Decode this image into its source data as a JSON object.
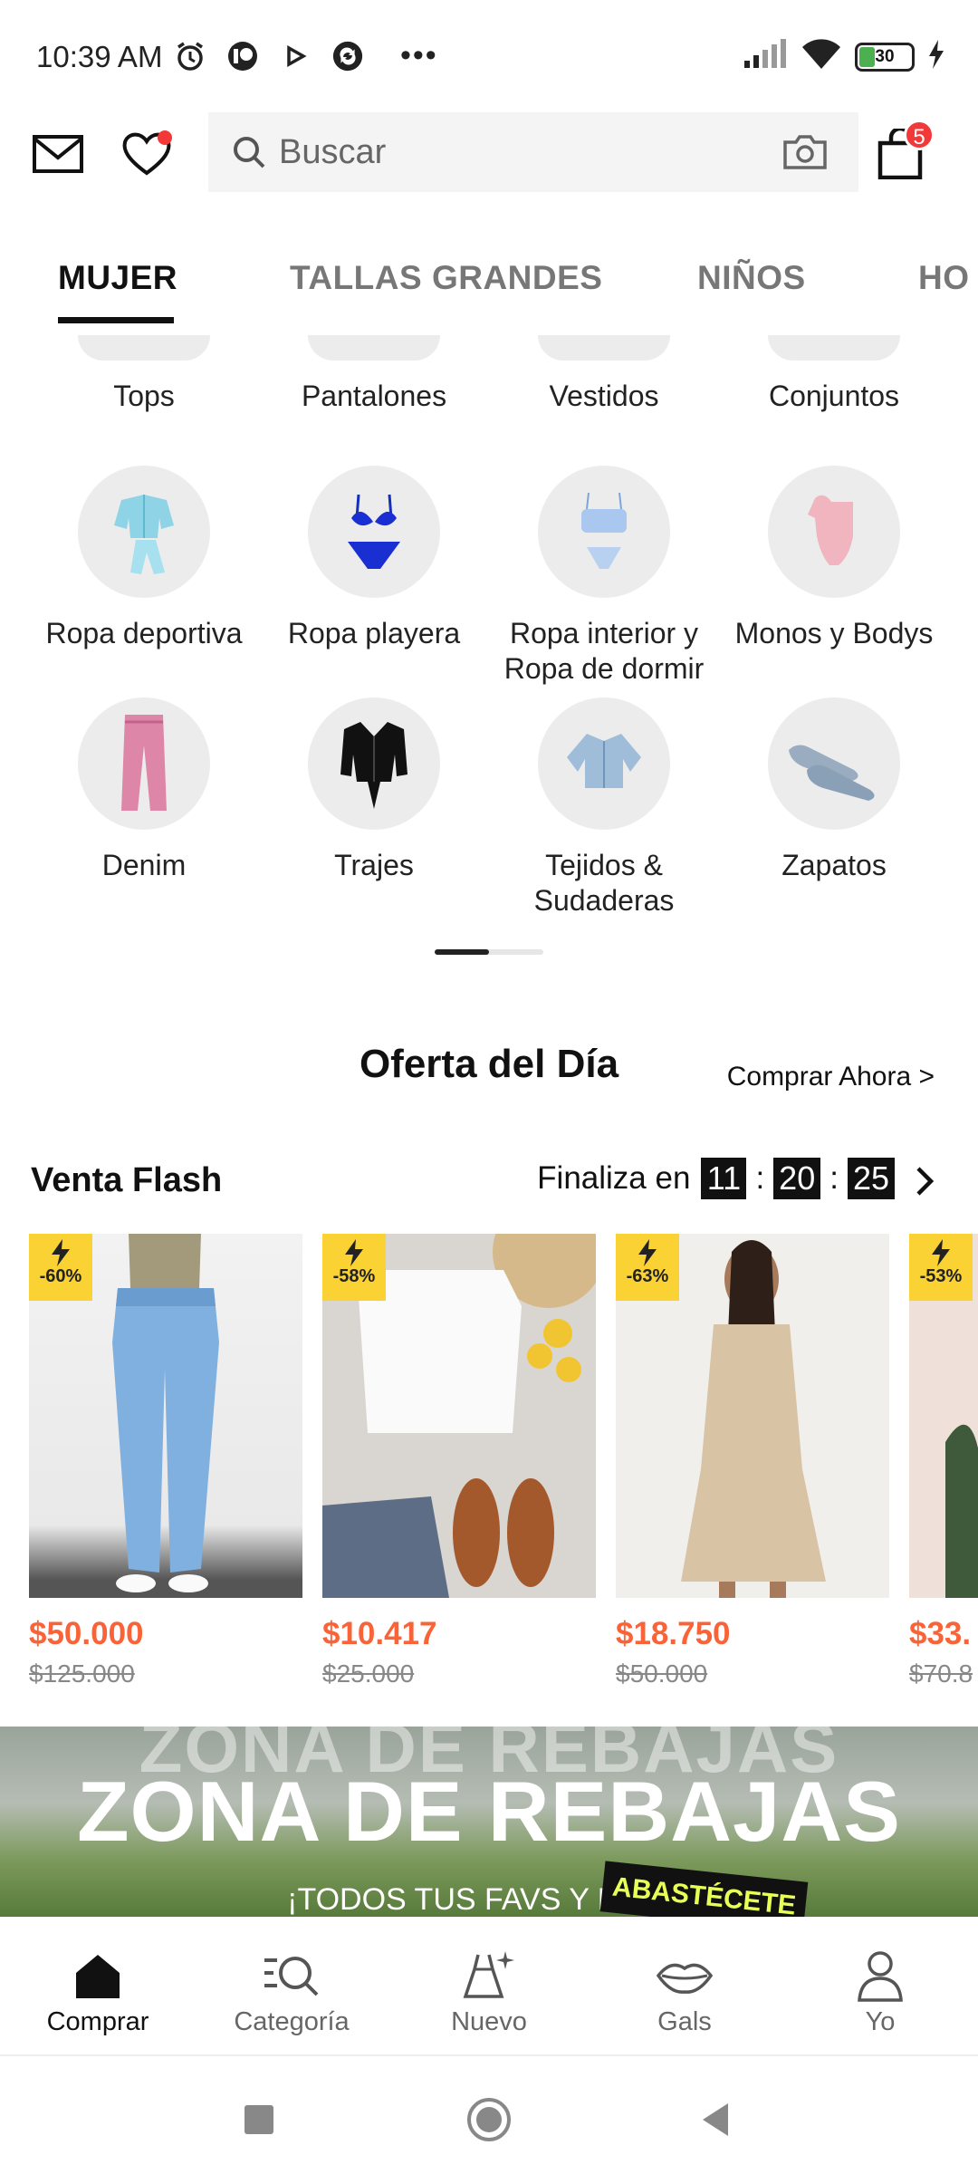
{
  "status_bar": {
    "time": "10:39 AM",
    "battery_level": "30",
    "icons": [
      "alarm-icon",
      "app-icon",
      "play-icon",
      "sync-icon",
      "more-dots-icon",
      "signal-icon",
      "wifi-icon",
      "battery-icon",
      "charging-icon"
    ]
  },
  "header": {
    "search_placeholder": "Buscar",
    "cart_count": "5",
    "accent_color": "#f23838"
  },
  "tabs": [
    {
      "label": "MUJER",
      "active": true
    },
    {
      "label": "TALLAS GRANDES",
      "active": false
    },
    {
      "label": "NIÑOS",
      "active": false
    },
    {
      "label": "HO",
      "active": false
    }
  ],
  "categories_top_row": [
    "Tops",
    "Pantalones",
    "Vestidos",
    "Conjuntos"
  ],
  "categories": [
    {
      "label": "Ropa deportiva",
      "icon": "sportswear-icon"
    },
    {
      "label": "Ropa playera",
      "icon": "bikini-icon"
    },
    {
      "label": "Ropa interior y Ropa de dormir",
      "icon": "lingerie-icon"
    },
    {
      "label": "Monos y Bodys",
      "icon": "bodysuit-icon"
    },
    {
      "label": "Denim",
      "icon": "jeans-icon"
    },
    {
      "label": "Trajes",
      "icon": "suit-icon"
    },
    {
      "label": "Tejidos & Sudaderas",
      "icon": "cardigan-icon"
    },
    {
      "label": "Zapatos",
      "icon": "shoes-icon"
    }
  ],
  "deal": {
    "title": "Oferta del Día",
    "shop_now": "Comprar Ahora >"
  },
  "flash_sale": {
    "title": "Venta Flash",
    "ends_label": "Finaliza en",
    "hours": "11",
    "minutes": "20",
    "seconds": "25"
  },
  "products": [
    {
      "discount": "-60%",
      "price": "$50.000",
      "original_price": "$125.000"
    },
    {
      "discount": "-58%",
      "price": "$10.417",
      "original_price": "$25.000"
    },
    {
      "discount": "-63%",
      "price": "$18.750",
      "original_price": "$50.000"
    },
    {
      "discount": "-53%",
      "price": "$33.",
      "original_price": "$70.8"
    }
  ],
  "banner": {
    "ghost_text": "ZONA DE REBAJAS",
    "title": "ZONA DE REBAJAS",
    "subtitle": "¡TODOS TUS FAVS Y MÁS!",
    "tag": "ABASTÉCETE"
  },
  "bottom_nav": [
    {
      "label": "Comprar",
      "icon": "home-icon",
      "active": true
    },
    {
      "label": "Categoría",
      "icon": "category-search-icon",
      "active": false
    },
    {
      "label": "Nuevo",
      "icon": "new-dress-icon",
      "active": false
    },
    {
      "label": "Gals",
      "icon": "lips-icon",
      "active": false
    },
    {
      "label": "Yo",
      "icon": "profile-icon",
      "active": false
    }
  ]
}
